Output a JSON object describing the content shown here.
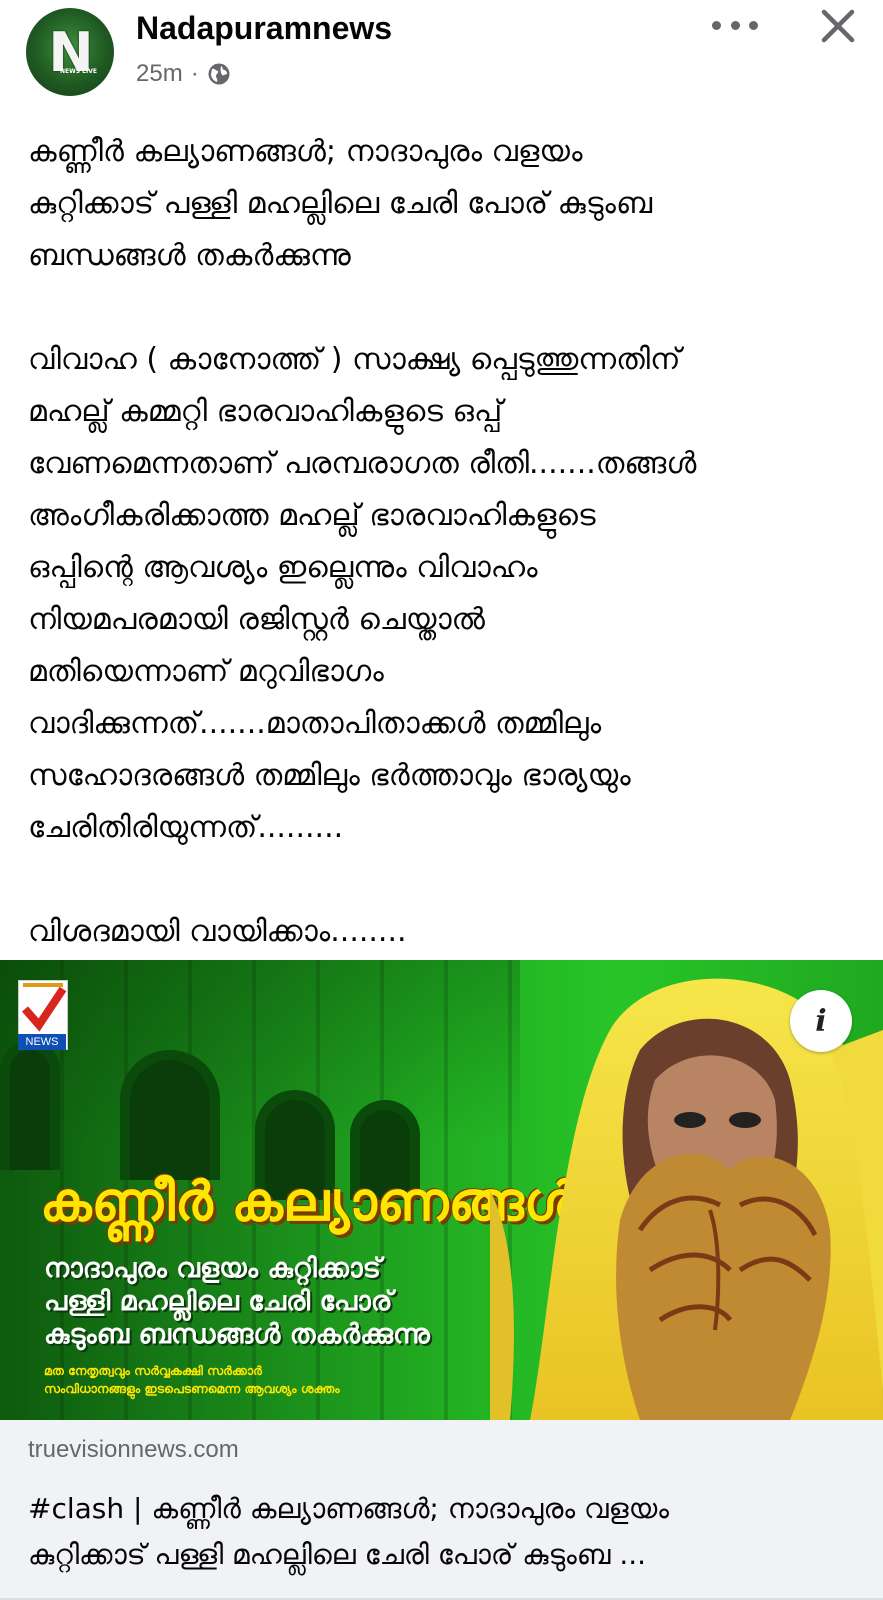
{
  "post": {
    "page_name": "Nadapuramnews",
    "avatar_letter": "N",
    "avatar_caption": "NEWS LIVE",
    "time": "25m",
    "separator": "·",
    "audience_icon": "globe-icon",
    "more_icon": "more-dots-icon",
    "close_icon": "close-icon"
  },
  "text": {
    "lines": [
      "കണ്ണീർ കല്യാണങ്ങൾ; നാദാപുരം വളയം",
      "കുറ്റിക്കാട് പള്ളി മഹല്ലിലെ ചേരി പോര് കുടുംബ",
      "ബന്ധങ്ങൾ തകർക്കുന്നു",
      "",
      "വിവാഹ ( കാനോത്ത് ) സാക്ഷ്യ പ്പെടുത്തുന്നതിന്",
      "മഹല്ല് കമ്മറ്റി ഭാരവാഹികളുടെ ഒപ്പ്",
      "വേണമെന്നതാണ് പരമ്പരാഗത രീതി.......തങ്ങൾ",
      "അംഗീകരിക്കാത്ത മഹല്ല് ഭാരവാഹികളുടെ",
      "ഒപ്പിന്റെ ആവശ്യം ഇല്ലെന്നും വിവാഹം",
      "നിയമപരമായി രജിസ്റ്റർ ചെയ്താൽ",
      "മതിയെന്നാണ് മറുവിഭാഗം",
      "വാദിക്കുന്നത്.......മാതാപിതാക്കൾ തമ്മിലും",
      "സഹോദരങ്ങൾ തമ്മിലും ഭർത്താവും ഭാര്യയും",
      "ചേരിതിരിയുന്നത്.........",
      "",
      "വിശദമായി വായിക്കാം........"
    ]
  },
  "link": {
    "image": {
      "logo_label": "NEWS",
      "headline": "കണ്ണീർ കല്യാണങ്ങൾ",
      "sub_lines": [
        "നാദാപുരം വളയം കുറ്റിക്കാട്",
        "പള്ളി മഹല്ലിലെ ചേരി പോര്",
        "കുടുംബ ബന്ധങ്ങൾ തകർക്കുന്നു"
      ],
      "small_lines": [
        "മത നേതൃത്വവും സർവ്വകക്ഷി സർക്കാർ",
        "സംവിധാനങ്ങളും ഇടപെടണമെന്ന ആവശ്യം ശക്തം"
      ],
      "info_label": "i"
    },
    "domain": "truevisionnews.com",
    "title_lines": [
      "#clash | കണ്ണീർ കല്യാണങ്ങൾ; നാദാപുരം വളയം",
      "കുറ്റിക്കാട് പള്ളി മഹല്ലിലെ ചേരി പോര് കുടുംബ ..."
    ]
  }
}
